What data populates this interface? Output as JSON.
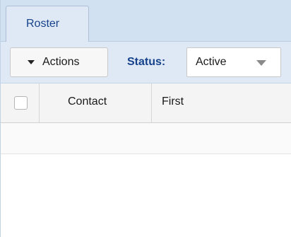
{
  "tabs": [
    {
      "label": "Roster",
      "active": true
    }
  ],
  "toolbar": {
    "actions_label": "Actions",
    "status_label": "Status:",
    "status_value": "Active"
  },
  "grid": {
    "columns": [
      "Contact",
      "First"
    ],
    "rows": []
  },
  "colors": {
    "tabstrip_bg": "#d2e1f2",
    "accent_text": "#15428b",
    "header_bg": "#f4f4f4"
  },
  "icons": {
    "actions": "caret-down-icon",
    "status_select": "chevron-down-icon"
  }
}
